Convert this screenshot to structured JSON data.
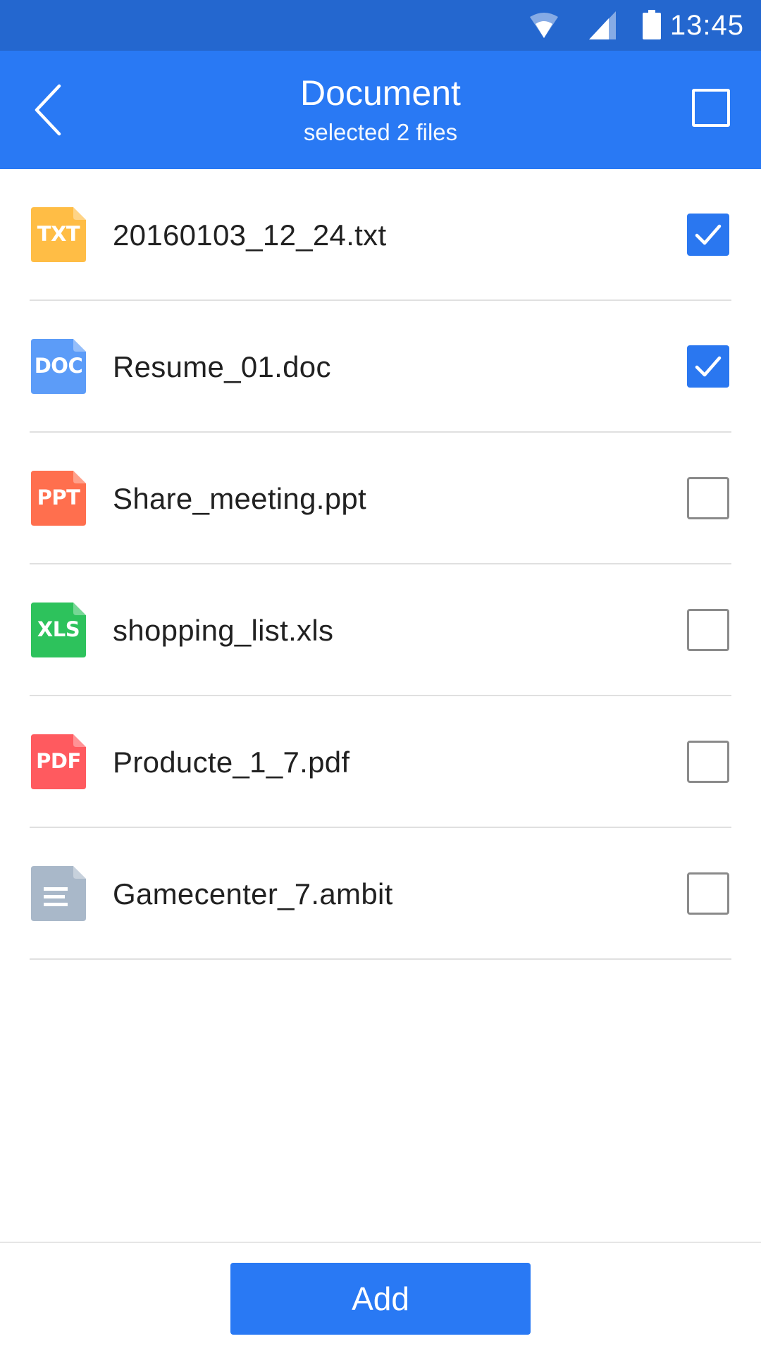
{
  "status_bar": {
    "time": "13:45",
    "icons": [
      "wifi-icon",
      "cell-signal-icon",
      "battery-icon"
    ]
  },
  "app_bar": {
    "title": "Document",
    "subtitle": "selected 2 files",
    "back_icon": "chevron-left-icon",
    "select_all_checked": false
  },
  "files": [
    {
      "name": "20160103_12_24.txt",
      "badge": "TXT",
      "icon": "txt-file-icon",
      "color": "#ffbd45",
      "checked": true
    },
    {
      "name": "Resume_01.doc",
      "badge": "DOC",
      "icon": "doc-file-icon",
      "color": "#5c9cf8",
      "checked": true
    },
    {
      "name": "Share_meeting.ppt",
      "badge": "PPT",
      "icon": "ppt-file-icon",
      "color": "#ff6f4e",
      "checked": false
    },
    {
      "name": "shopping_list.xls",
      "badge": "XLS",
      "icon": "xls-file-icon",
      "color": "#2dc25c",
      "checked": false
    },
    {
      "name": "Producte_1_7.pdf",
      "badge": "PDF",
      "icon": "pdf-file-icon",
      "color": "#ff5a5f",
      "checked": false
    },
    {
      "name": "Gamecenter_7.ambit",
      "badge": "",
      "icon": "generic-file-icon",
      "color": "#a9b8c9",
      "checked": false
    }
  ],
  "footer": {
    "add_label": "Add"
  },
  "colors": {
    "status_bar": "#2467cf",
    "app_bar": "#2979f4",
    "checkbox_checked": "#2a77f0",
    "checkbox_border": "#8a8a8a",
    "divider": "#e0e0e0",
    "text_primary": "#212121"
  }
}
